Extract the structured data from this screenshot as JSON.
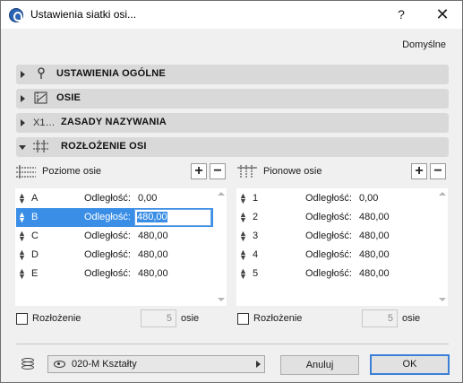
{
  "window": {
    "title": "Ustawienia siatki osi...",
    "help_label": "?",
    "close_label": "✕"
  },
  "header": {
    "defaults_label": "Domyślne"
  },
  "sections": [
    {
      "label": "USTAWIENIA OGÓLNE",
      "icon": "pin-icon",
      "expanded": false
    },
    {
      "label": "OSIE",
      "icon": "axis-box-icon",
      "expanded": false
    },
    {
      "label": "ZASADY NAZYWANIA",
      "icon": "naming-icon",
      "icon_text": "X1…",
      "expanded": false
    },
    {
      "label": "ROZŁOŻENIE OSI",
      "icon": "grid-layout-icon",
      "expanded": true
    }
  ],
  "horizontal": {
    "label": "Poziome osie",
    "add_label": "+",
    "remove_label": "−",
    "rows": [
      {
        "name": "A",
        "dist_label": "Odległość:",
        "value": "0,00",
        "selected": false
      },
      {
        "name": "B",
        "dist_label": "Odległość:",
        "value": "480,00",
        "selected": true
      },
      {
        "name": "C",
        "dist_label": "Odległość:",
        "value": "480,00",
        "selected": false
      },
      {
        "name": "D",
        "dist_label": "Odległość:",
        "value": "480,00",
        "selected": false
      },
      {
        "name": "E",
        "dist_label": "Odległość:",
        "value": "480,00",
        "selected": false
      }
    ],
    "distribute_label": "Rozłożenie",
    "count_value": "5",
    "count_unit": "osie"
  },
  "vertical": {
    "label": "Pionowe osie",
    "add_label": "+",
    "remove_label": "−",
    "rows": [
      {
        "name": "1",
        "dist_label": "Odległość:",
        "value": "0,00",
        "selected": false
      },
      {
        "name": "2",
        "dist_label": "Odległość:",
        "value": "480,00",
        "selected": false
      },
      {
        "name": "3",
        "dist_label": "Odległość:",
        "value": "480,00",
        "selected": false
      },
      {
        "name": "4",
        "dist_label": "Odległość:",
        "value": "480,00",
        "selected": false
      },
      {
        "name": "5",
        "dist_label": "Odległość:",
        "value": "480,00",
        "selected": false
      }
    ],
    "distribute_label": "Rozłożenie",
    "count_value": "5",
    "count_unit": "osie"
  },
  "footer": {
    "layer_value": "020-M Kształty",
    "cancel_label": "Anuluj",
    "ok_label": "OK"
  },
  "colors": {
    "accent": "#3a8ee6",
    "section_bg": "#d9d9d9",
    "dialog_bg": "#f0f0f0"
  }
}
